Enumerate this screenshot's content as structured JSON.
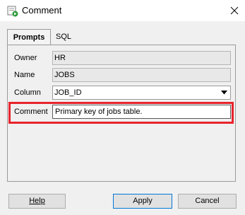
{
  "window": {
    "title": "Comment"
  },
  "tabs": [
    {
      "label": "Prompts",
      "selected": true
    },
    {
      "label": "SQL",
      "selected": false
    }
  ],
  "form": {
    "owner": {
      "label": "Owner",
      "value": "HR"
    },
    "name": {
      "label": "Name",
      "value": "JOBS"
    },
    "column": {
      "label": "Column",
      "value": "JOB_ID"
    },
    "comment": {
      "label": "Comment",
      "value": "Primary key of jobs table."
    }
  },
  "buttons": {
    "help": "Help",
    "apply": "Apply",
    "cancel": "Cancel"
  },
  "icons": {
    "app": "comment-app-icon",
    "close": "close-icon",
    "dropdown": "chevron-down-icon"
  },
  "colors": {
    "highlight": "#e8242d",
    "focus_border": "#0078d7"
  }
}
